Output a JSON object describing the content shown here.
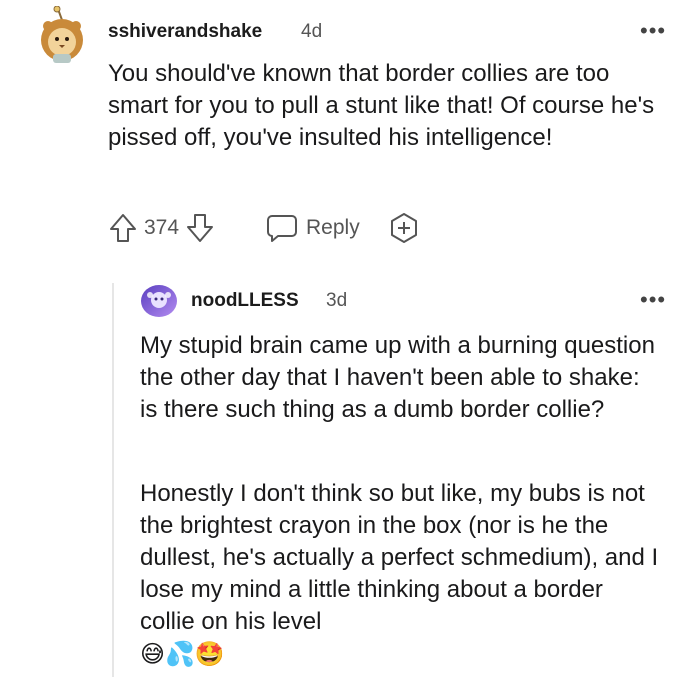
{
  "comment": {
    "username": "sshiverandshake",
    "age": "4d",
    "body": "You should've known that border collies are too smart for you to pull a stunt like that! Of course he's pissed off, you've insulted his intelligence!",
    "votes": "374",
    "reply_label": "Reply",
    "more_label": "•••"
  },
  "reply": {
    "username": "noodLLESS",
    "age": "3d",
    "paragraph1": "My stupid brain came up with a burning question the other day that I haven't been able to shake: is there such thing as a dumb border collie?",
    "paragraph2": "Honestly I don't think so but like, my bubs is not the brightest crayon in the box (nor is he the dullest, he's actually a perfect schmedium), and I lose my mind a little thinking about a border collie on his level",
    "emojis": "😅💦🤩",
    "more_label": "•••"
  },
  "icons": {
    "upvote": "upvote-icon",
    "downvote": "downvote-icon",
    "reply": "speech-bubble-icon",
    "award": "add-award-icon"
  },
  "colors": {
    "text": "#1a1a1b",
    "muted": "#555555",
    "thread_line": "#e6e6e6"
  }
}
